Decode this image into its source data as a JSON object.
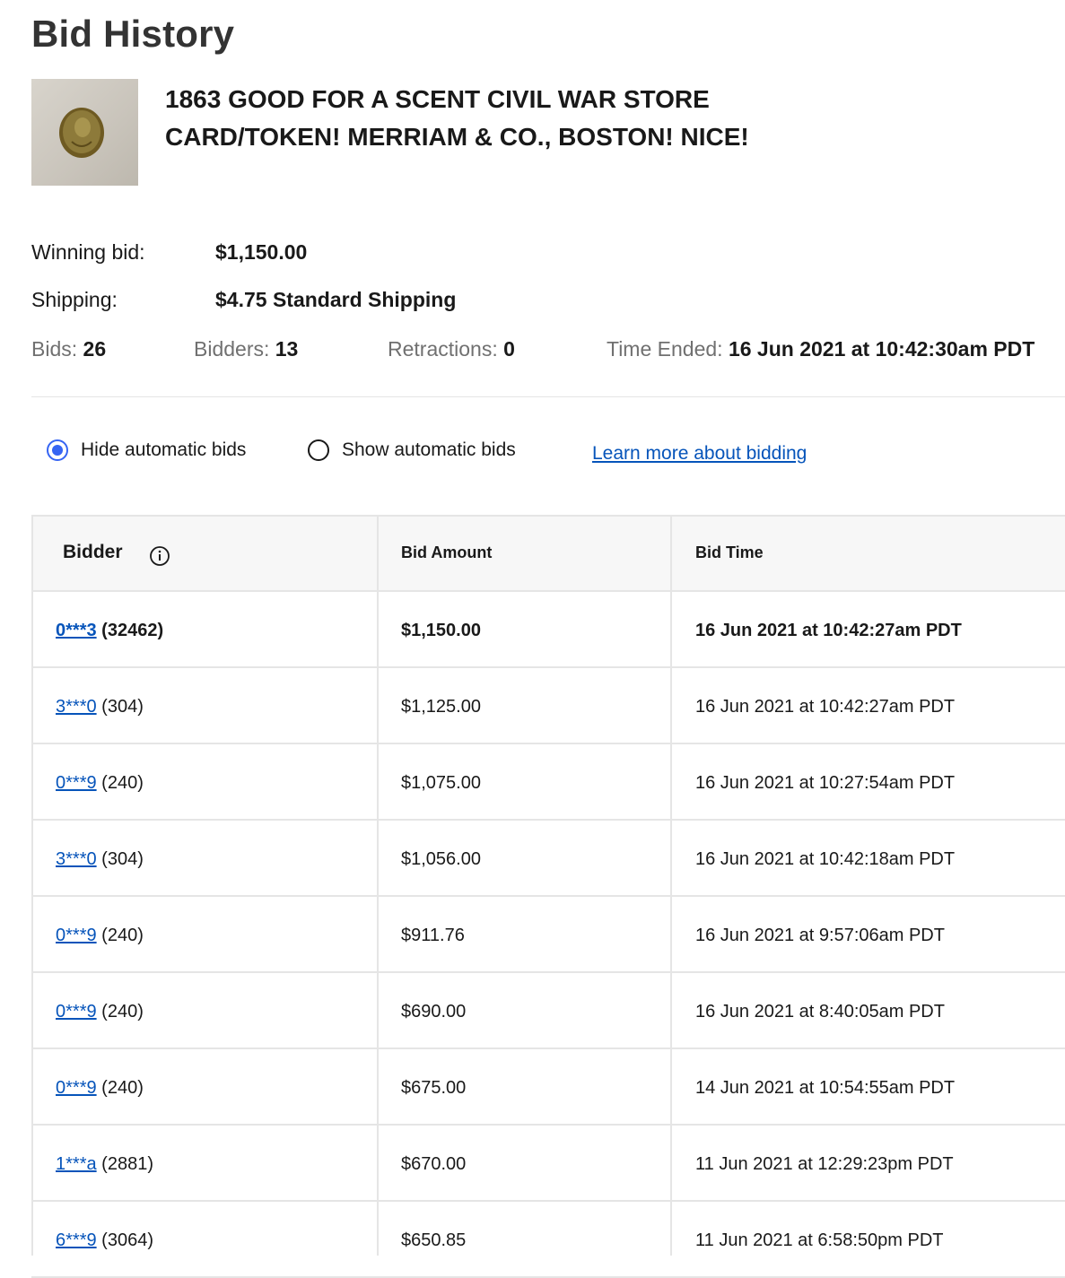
{
  "page": {
    "title": "Bid History"
  },
  "item": {
    "title": "1863 GOOD FOR A SCENT CIVIL WAR STORE CARD/TOKEN! MERRIAM & CO., BOSTON! NICE!"
  },
  "summary": {
    "winning_bid_label": "Winning bid:",
    "winning_bid_value": "$1,150.00",
    "shipping_label": "Shipping:",
    "shipping_value": "$4.75 Standard Shipping",
    "bids_label": "Bids:",
    "bids_value": "26",
    "bidders_label": "Bidders:",
    "bidders_value": "13",
    "retractions_label": "Retractions:",
    "retractions_value": "0",
    "time_ended_label": "Time Ended:",
    "time_ended_value": "16 Jun 2021 at 10:42:30am PDT"
  },
  "filters": {
    "hide_label": "Hide automatic bids",
    "show_label": "Show automatic bids",
    "selected": "hide",
    "learn_more": "Learn more about bidding"
  },
  "table": {
    "headers": {
      "bidder": "Bidder",
      "amount": "Bid Amount",
      "time": "Bid Time"
    },
    "rows": [
      {
        "bidder": "0***3",
        "score": "(32462)",
        "amount": "$1,150.00",
        "time": "16 Jun 2021 at 10:42:27am PDT",
        "winning": true
      },
      {
        "bidder": "3***0",
        "score": "(304)",
        "amount": "$1,125.00",
        "time": "16 Jun 2021 at 10:42:27am PDT",
        "winning": false
      },
      {
        "bidder": "0***9",
        "score": "(240)",
        "amount": "$1,075.00",
        "time": "16 Jun 2021 at 10:27:54am PDT",
        "winning": false
      },
      {
        "bidder": "3***0",
        "score": "(304)",
        "amount": "$1,056.00",
        "time": "16 Jun 2021 at 10:42:18am PDT",
        "winning": false
      },
      {
        "bidder": "0***9",
        "score": "(240)",
        "amount": "$911.76",
        "time": "16 Jun 2021 at 9:57:06am PDT",
        "winning": false
      },
      {
        "bidder": "0***9",
        "score": "(240)",
        "amount": "$690.00",
        "time": "16 Jun 2021 at 8:40:05am PDT",
        "winning": false
      },
      {
        "bidder": "0***9",
        "score": "(240)",
        "amount": "$675.00",
        "time": "14 Jun 2021 at 10:54:55am PDT",
        "winning": false
      },
      {
        "bidder": "1***a",
        "score": "(2881)",
        "amount": "$670.00",
        "time": "11 Jun 2021 at 12:29:23pm PDT",
        "winning": false
      },
      {
        "bidder": "6***9",
        "score": "(3064)",
        "amount": "$650.85",
        "time": "11 Jun 2021 at 6:58:50pm PDT",
        "winning": false
      }
    ]
  },
  "colors": {
    "link": "#0654ba",
    "radio_selected": "#3665f3",
    "border": "#e5e5e5",
    "header_bg": "#f7f7f7"
  }
}
